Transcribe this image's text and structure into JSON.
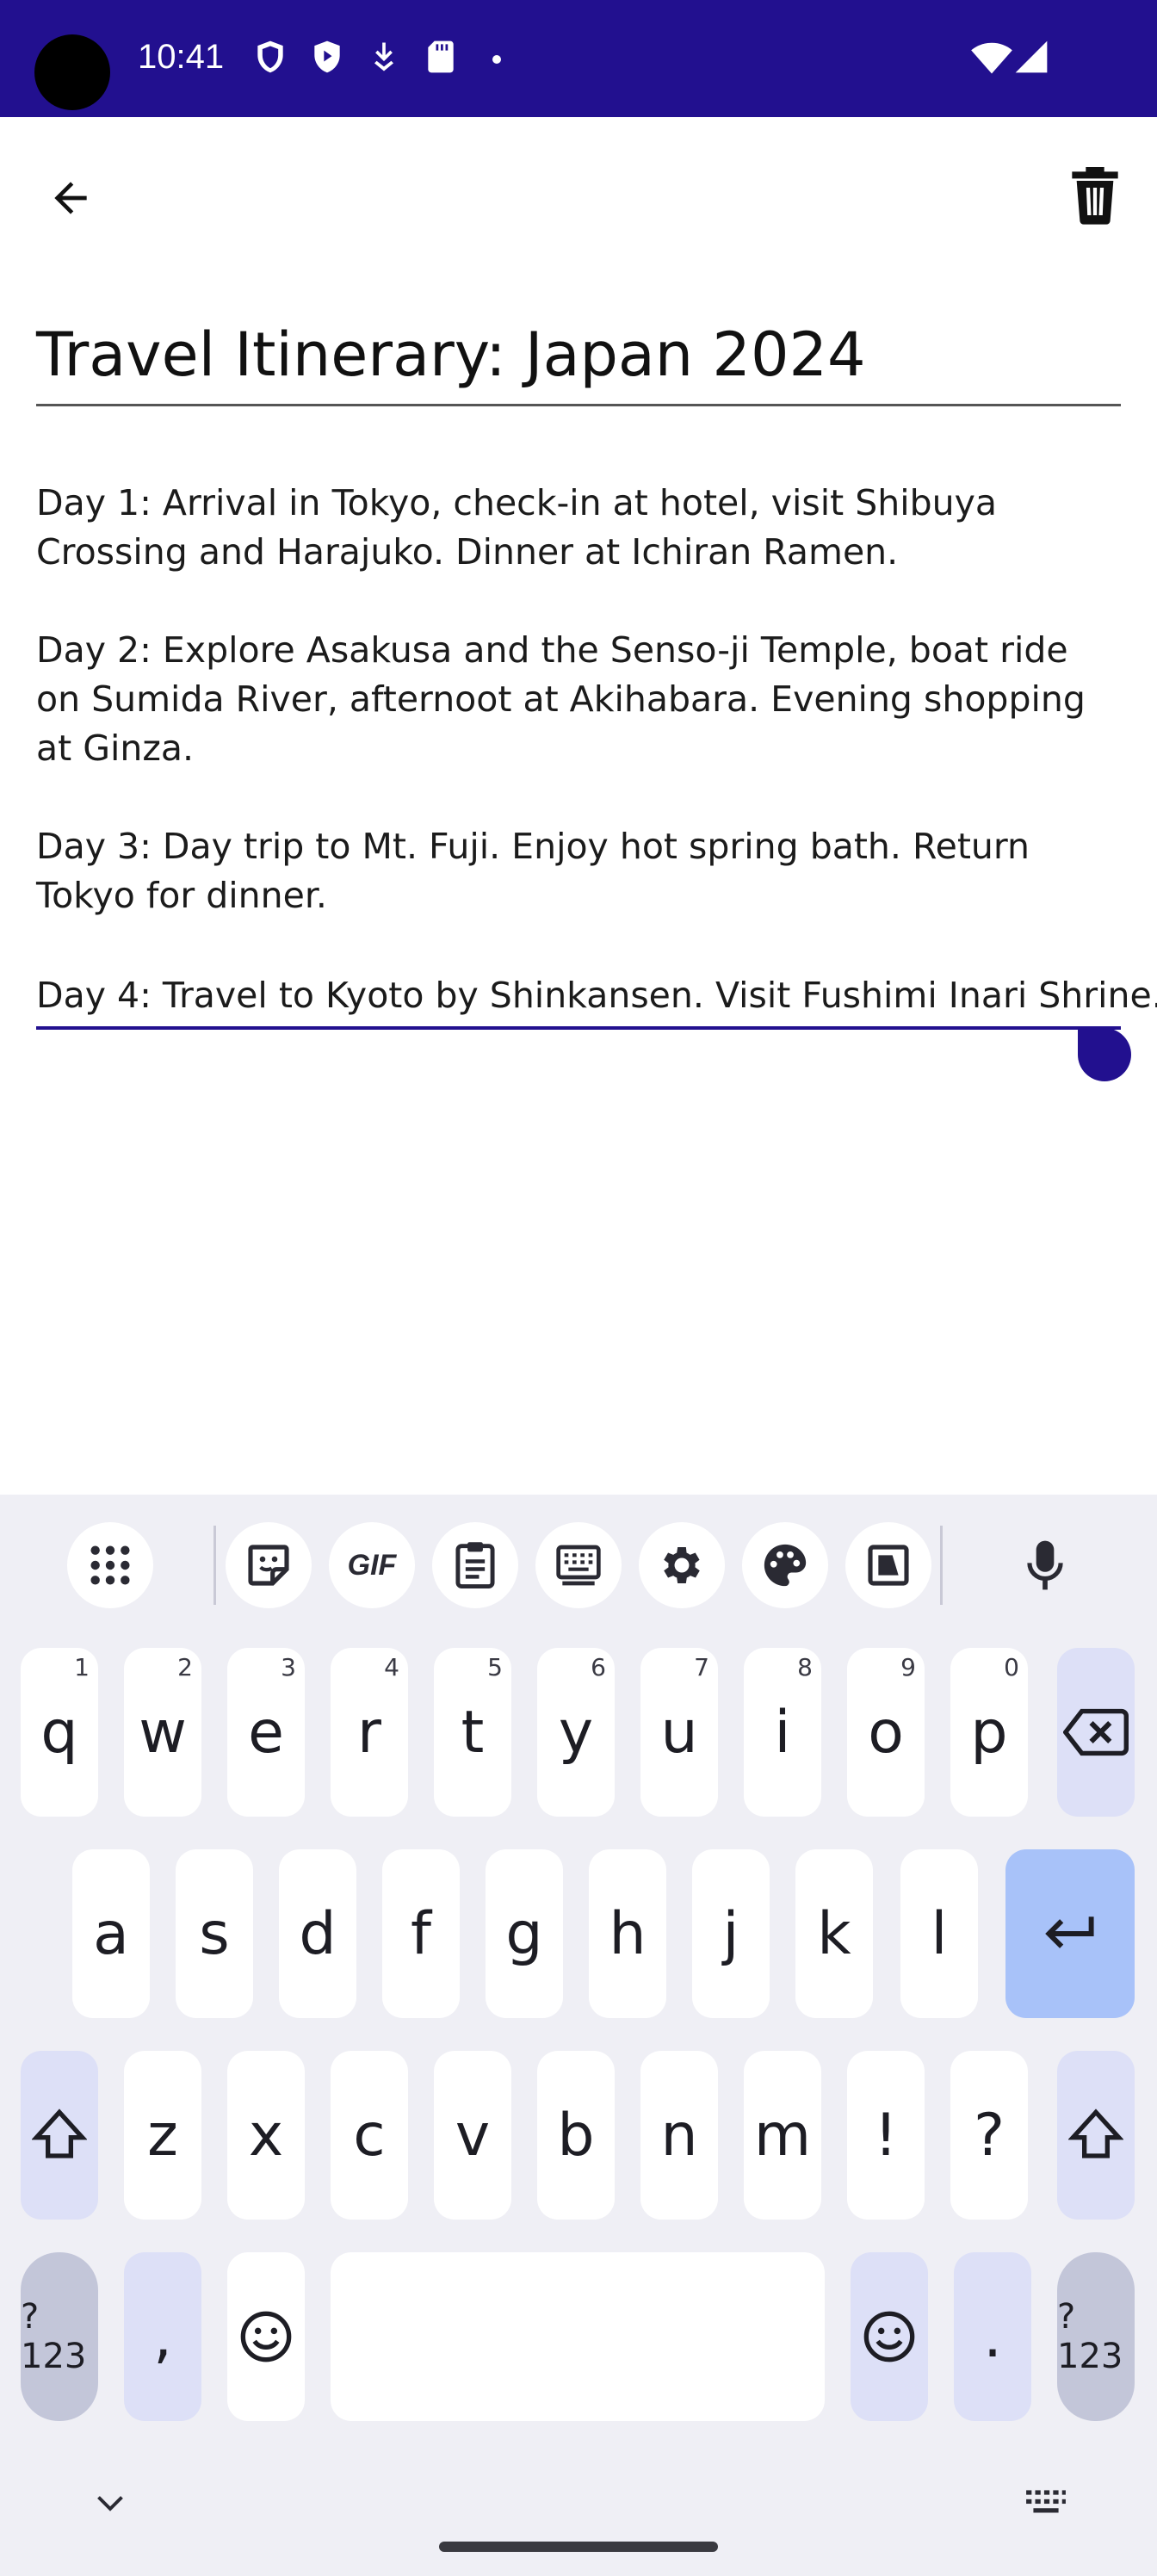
{
  "status_bar": {
    "time": "10:41"
  },
  "note": {
    "title": "Travel Itinerary: Japan 2024",
    "paragraphs": [
      "Day 1: Arrival in Tokyo, check-in at hotel, visit Shibuya Crossing and Harajuko. Dinner at Ichiran Ramen.",
      "Day 2: Explore Asakusa and the Senso-ji Temple, boat ride on Sumida River, afternoot at Akihabara. Evening shopping at Ginza.",
      "Day 3: Day trip to Mt. Fuji. Enjoy hot spring bath. Return Tokyo for dinner.",
      "Day 4: Travel to Kyoto by Shinkansen. Visit Fushimi Inari Shrine."
    ]
  },
  "keyboard": {
    "toolbar": [
      "apps-grid-icon",
      "sticker-icon",
      "gif-icon",
      "clipboard-icon",
      "keyboard-layout-icon",
      "settings-icon",
      "palette-icon",
      "screenshot-icon",
      "mic-icon"
    ],
    "gif_label": "GIF",
    "row1": [
      {
        "key": "q",
        "hint": "1"
      },
      {
        "key": "w",
        "hint": "2"
      },
      {
        "key": "e",
        "hint": "3"
      },
      {
        "key": "r",
        "hint": "4"
      },
      {
        "key": "t",
        "hint": "5"
      },
      {
        "key": "y",
        "hint": "6"
      },
      {
        "key": "u",
        "hint": "7"
      },
      {
        "key": "i",
        "hint": "8"
      },
      {
        "key": "o",
        "hint": "9"
      },
      {
        "key": "p",
        "hint": "0"
      }
    ],
    "row2": [
      "a",
      "s",
      "d",
      "f",
      "g",
      "h",
      "j",
      "k",
      "l"
    ],
    "row3": [
      "z",
      "x",
      "c",
      "v",
      "b",
      "n",
      "m",
      "!",
      "?"
    ],
    "symbols_label": "?123",
    "comma": ",",
    "period": ".",
    "accent_color": "#22108f",
    "enter_color": "#a8c2f9"
  }
}
